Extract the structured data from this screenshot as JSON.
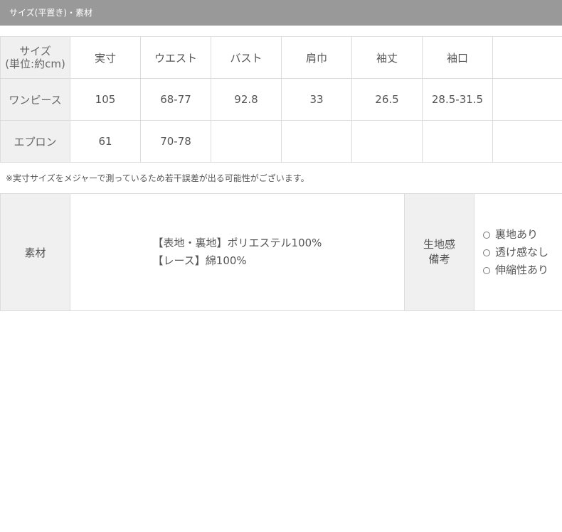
{
  "section_title": "サイズ(平置き)・素材",
  "size_table": {
    "corner": [
      "サイズ",
      "(単位:約cm)"
    ],
    "headers": [
      "実寸",
      "ウエスト",
      "バスト",
      "肩巾",
      "袖丈",
      "袖口",
      ""
    ],
    "rows": [
      {
        "label": "ワンピース",
        "cells": [
          "105",
          "68-77",
          "92.8",
          "33",
          "26.5",
          "28.5-31.5",
          ""
        ]
      },
      {
        "label": "エプロン",
        "cells": [
          "61",
          "70-78",
          "",
          "",
          "",
          "",
          ""
        ]
      }
    ]
  },
  "note": "※実寸サイズをメジャーで測っているため若干誤差が出る可能性がございます。",
  "material": {
    "label": "素材",
    "lines": [
      "【表地・裏地】ポリエステル100%",
      "【レース】綿100%"
    ],
    "feel_label": [
      "生地感",
      "備考"
    ],
    "options": [
      "裏地あり",
      "透け感なし",
      "伸縮性あり"
    ]
  }
}
